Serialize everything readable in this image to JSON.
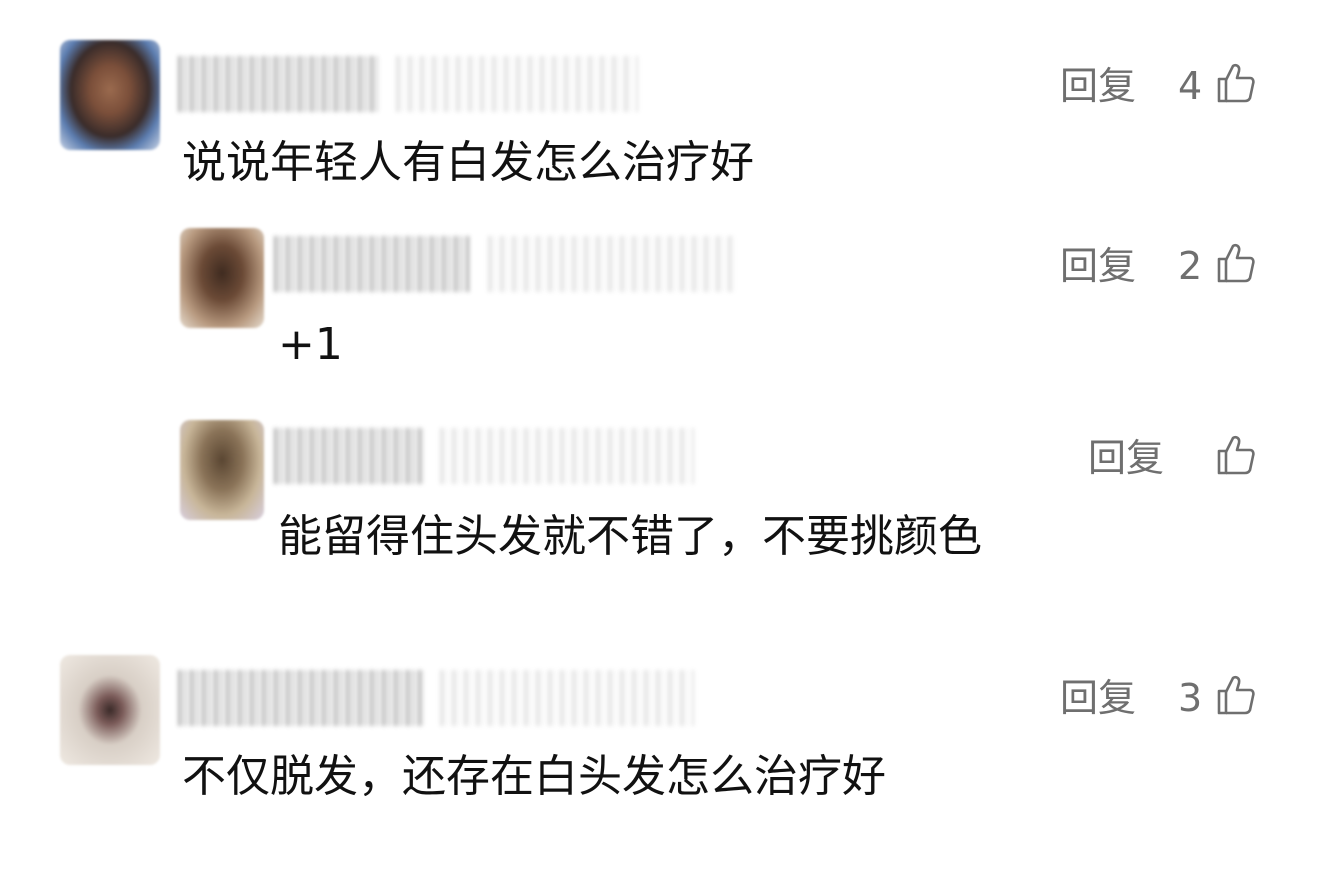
{
  "labels": {
    "reply": "回复"
  },
  "comments": [
    {
      "likes": "4",
      "text": "说说年轻人有白发怎么治疗好"
    },
    {
      "likes": "2",
      "text": "+1"
    },
    {
      "likes": "",
      "text": "能留得住头发就不错了，不要挑颜色"
    },
    {
      "likes": "3",
      "text": "不仅脱发，还存在白头发怎么治疗好"
    }
  ],
  "colors": {
    "text": "#111111",
    "meta": "#6f6f6f",
    "background": "#ffffff"
  },
  "icons": {
    "like": "thumbs-up-icon",
    "avatar": "user-avatar"
  }
}
